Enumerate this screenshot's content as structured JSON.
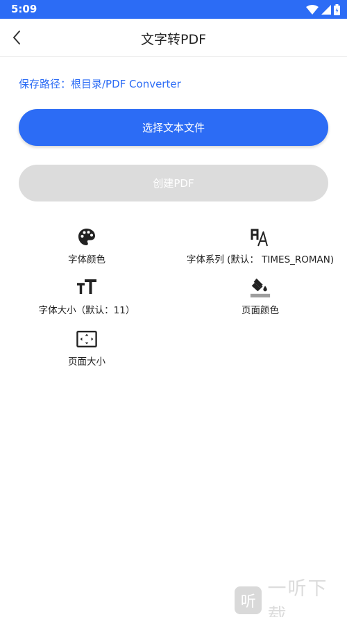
{
  "status_bar": {
    "time": "5:09",
    "bg_color": "#2c6cf5"
  },
  "app_bar": {
    "title": "文字转PDF",
    "back_icon": "chevron-left-icon"
  },
  "save_path": {
    "text": "保存路径：根目录/PDF Converter"
  },
  "buttons": {
    "select_text_file": "选择文本文件",
    "create_pdf": "创建PDF"
  },
  "options": {
    "font_color": {
      "label": "字体颜色",
      "icon": "palette-icon"
    },
    "font_family": {
      "label": "字体系列 (默认： TIMES_ROMAN)",
      "icon": "font-family-icon"
    },
    "font_size": {
      "label": "字体大小（默认：11）",
      "icon": "font-size-icon"
    },
    "page_color": {
      "label": "页面颜色",
      "icon": "paint-bucket-icon"
    },
    "page_size": {
      "label": "页面大小",
      "icon": "page-size-icon"
    }
  },
  "watermark": {
    "badge": "听",
    "text": "一听下载"
  },
  "colors": {
    "accent": "#2c6cf5",
    "disabled": "#dcdcdc",
    "text": "#212121"
  }
}
